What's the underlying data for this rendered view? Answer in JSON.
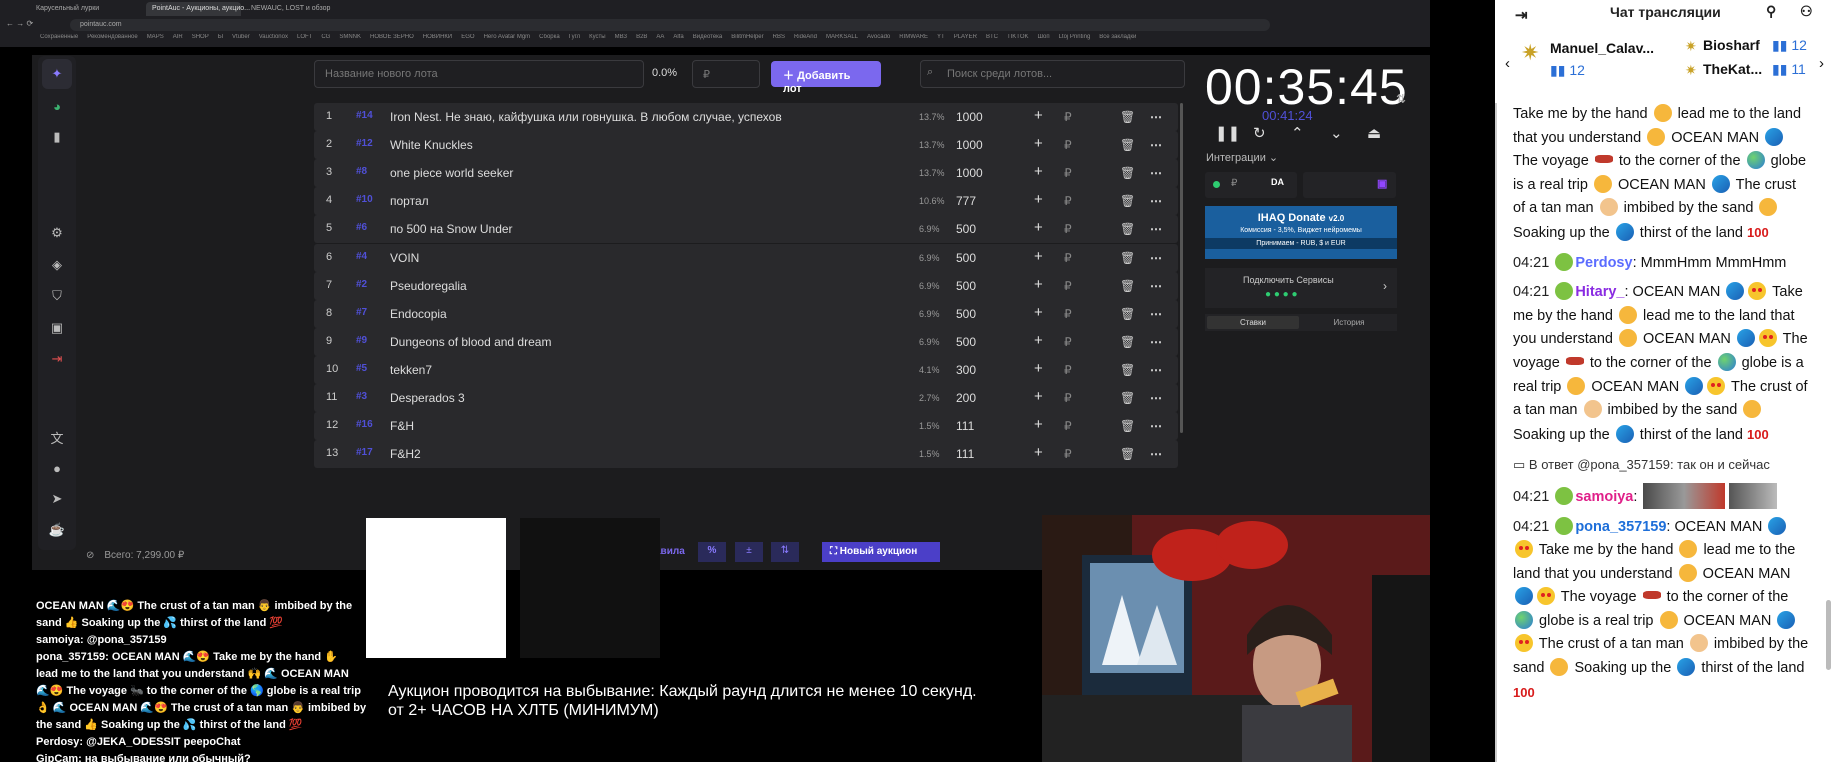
{
  "browser": {
    "tabs": [
      "Карусельный лурки",
      "PointAuc - Аукционы, аукцио...",
      "NEWAUC, LOST и обзор"
    ],
    "url": "pointauc.com",
    "bookmarks": [
      "Сохранённые",
      "Рекомендованное",
      "MAPS",
      "AIR",
      "SHOP",
      "Ы",
      "Vtuber",
      "Vauctionox",
      "LOFT",
      "CG",
      "SMNNK",
      "НОВОЕ ЗЕРНО",
      "НОВИНКИ",
      "EGO",
      "Hero Avatar Mgm",
      "Сборка",
      "Гугл",
      "Кусты",
      "МВЗ",
      "B2B",
      "AA",
      "Alfa",
      "Видеотека",
      "BilitmHelper",
      "RBS",
      "RideAnd",
      "MARKSALL",
      "Avocado",
      "RIMWARE",
      "YT",
      "PLAYER",
      "BTC",
      "TIKTOK",
      "Шоп",
      "Ltoj Printing",
      "Все закладки"
    ]
  },
  "toolbar": {
    "name_placeholder": "Название нового лота",
    "percent": "0.0%",
    "amount_placeholder": "₽",
    "add_label": "Добавить лот",
    "search_placeholder": "Поиск среди лотов..."
  },
  "nav": {
    "icons": [
      "logo-icon",
      "wheel-icon",
      "stats-icon",
      "settings-icon",
      "layers-icon",
      "shield-icon",
      "history-icon",
      "logout-icon",
      "translate-icon",
      "github-icon",
      "telegram-icon",
      "support-icon"
    ]
  },
  "lots": [
    {
      "idx": "1",
      "id": "#14",
      "name": "Iron Nest. Не знаю, кайфушка или говнушка. В любом случае, успехов",
      "pct": "13.7%",
      "amount": "1000"
    },
    {
      "idx": "2",
      "id": "#12",
      "name": "White Knuckles",
      "pct": "13.7%",
      "amount": "1000"
    },
    {
      "idx": "3",
      "id": "#8",
      "name": "one piece world seeker",
      "pct": "13.7%",
      "amount": "1000"
    },
    {
      "idx": "4",
      "id": "#10",
      "name": "портал",
      "pct": "10.6%",
      "amount": "777"
    },
    {
      "idx": "5",
      "id": "#6",
      "name": "по 500 на Snow Under",
      "pct": "6.9%",
      "amount": "500"
    },
    {
      "idx": "6",
      "id": "#4",
      "name": "VOIN",
      "pct": "6.9%",
      "amount": "500"
    },
    {
      "idx": "7",
      "id": "#2",
      "name": "Pseudoregalia",
      "pct": "6.9%",
      "amount": "500"
    },
    {
      "idx": "8",
      "id": "#7",
      "name": "Endocopia",
      "pct": "6.9%",
      "amount": "500"
    },
    {
      "idx": "9",
      "id": "#9",
      "name": "Dungeons of blood and dream",
      "pct": "6.9%",
      "amount": "500"
    },
    {
      "idx": "10",
      "id": "#5",
      "name": "tekken7",
      "pct": "4.1%",
      "amount": "300"
    },
    {
      "idx": "11",
      "id": "#3",
      "name": "Desperados 3",
      "pct": "2.7%",
      "amount": "200"
    },
    {
      "idx": "12",
      "id": "#16",
      "name": "F&H",
      "pct": "1.5%",
      "amount": "111"
    },
    {
      "idx": "13",
      "id": "#17",
      "name": "F&H2",
      "pct": "1.5%",
      "amount": "111"
    }
  ],
  "lot_currency": "₽",
  "timer": {
    "main": "00:35:45",
    "sub": "00:41:24"
  },
  "integrations": {
    "label": "Интеграции",
    "donate_title": "IHAQ Donate",
    "donate_ver": "v2.0",
    "donate_line": "Комиссия - 3,5%, Виджет нейромемы",
    "donate_accept": "Принимаем - RUB, $ и EUR",
    "services": "Подключить Сервисы",
    "tab_bets": "Ставки",
    "tab_history": "История"
  },
  "footer": {
    "total": "Всего: 7,299.00 ₽",
    "rules": "авила",
    "new_auction": "Новый аукцион"
  },
  "stream_overlay": {
    "ticker_line1": "Аукцион проводится на выбывание: Каждый раунд длится не менее 10 секунд.",
    "ticker_line2": "от 2+ ЧАСОВ НА ХЛТБ (МИНИМУМ)",
    "chat_lines": [
      "OCEAN MAN 🌊😍 The crust of a tan man 👨 imbibed by the",
      "sand 👍 Soaking up the 💦 thirst of the land 💯",
      "samoiya: @pona_357159",
      "pona_357159: OCEAN MAN 🌊😍 Take me by the hand ✋",
      "lead me to the land that you understand 🙌 🌊 OCEAN MAN",
      "🌊😍 The voyage 🐜 to the corner of the 🌎 globe is a real trip",
      "👌 🌊 OCEAN MAN 🌊😍 The crust of a tan man 👨 imbibed by",
      "the sand 👍 Soaking up the 💦 thirst of the land 💯",
      "Perdosy: @JEKA_ODESSIT peepoChat",
      "GipCam: на выбывание или обычный?"
    ]
  },
  "chat": {
    "title": "Чат трансляции",
    "pinned": [
      {
        "name": "Manuel_Calav...",
        "count": "12"
      },
      {
        "name": "Biosharf",
        "count": "12"
      },
      {
        "name": "TheKat...",
        "count": "11"
      }
    ],
    "messages": [
      {
        "time": "",
        "nick": "",
        "text": "Take me by the hand ✋ lead me to the land that you understand 🙌 OCEAN MAN 🌊 The voyage 🐜 to the corner of the 🌎 globe is a real trip 👌 OCEAN MAN 🌊 The crust of a tan man 👨 imbibed by the sand 👍 Soaking up the 💦 thirst of the land 💯"
      },
      {
        "time": "04:21",
        "nick": "Perdosy",
        "nick_color": "#5b6cff",
        "text": ": MmmHmm MmmHmm"
      },
      {
        "time": "04:21",
        "nick": "Hitary_",
        "nick_color": "#8a2be2",
        "text": ": OCEAN MAN 🌊😍 Take me by the hand ✋ lead me to the land that you understand 🙌 OCEAN MAN 🌊😍 The voyage 🐜 to the corner of the 🌎 globe is a real trip 👌 OCEAN MAN 🌊😍 The crust of a tan man 👨 imbibed by the sand 👍 Soaking up the 💦 thirst of the land 💯"
      },
      {
        "reply": "В ответ @pona_357159: так он и сейчас"
      },
      {
        "time": "04:21",
        "nick": "samoiya",
        "nick_color": "#e0218a",
        "text": ":"
      },
      {
        "time": "04:21",
        "nick": "pona_357159",
        "nick_color": "#1e6fd9",
        "text": ": OCEAN MAN 🌊😍 Take me by the hand ✋ lead me to the land that you understand 🙌 OCEAN MAN 🌊😍 The voyage 🐜 to the corner of the 🌎 globe is a real trip 👌 OCEAN MAN 🌊😍 The crust of a tan man 👨 imbibed by the sand 👍 Soaking up the 💦 thirst of the land 💯"
      }
    ]
  }
}
